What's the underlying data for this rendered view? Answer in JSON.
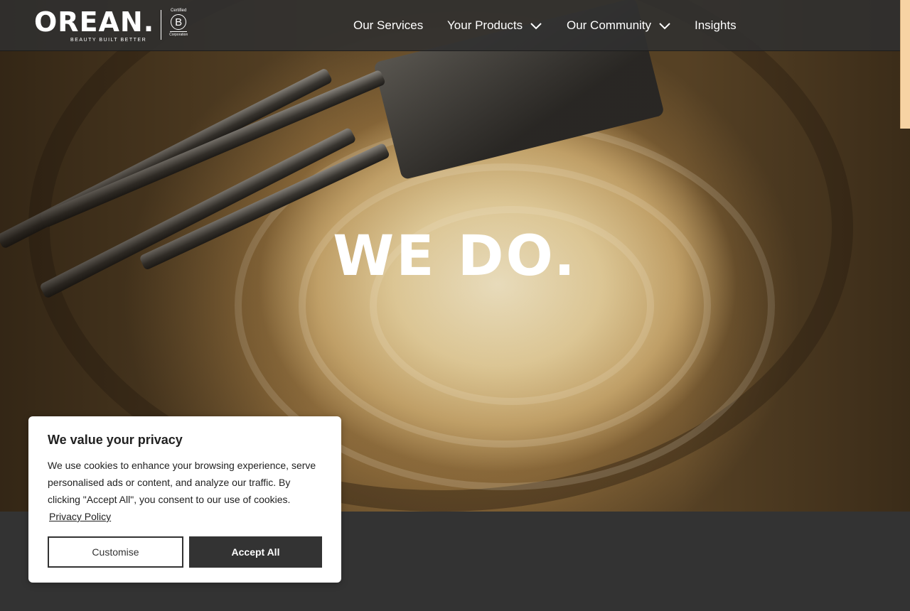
{
  "header": {
    "logo": {
      "wordmark": "OREAN.",
      "tagline": "BEAUTY BUILT BETTER",
      "bcorp_top": "Certified",
      "bcorp_letter": "B",
      "bcorp_bottom": "Corporation"
    },
    "nav": [
      {
        "label": "Our Services",
        "has_dropdown": false
      },
      {
        "label": "Your Products",
        "has_dropdown": true
      },
      {
        "label": "Our Community",
        "has_dropdown": true
      },
      {
        "label": "Insights",
        "has_dropdown": false
      }
    ]
  },
  "hero": {
    "headline": "WE DO."
  },
  "cookie_banner": {
    "title": "We value your privacy",
    "body": "We use cookies to enhance your browsing experience, serve personalised ads or content, and analyze our traffic. By clicking \"Accept All\", you consent to our use of cookies.",
    "policy_link": "Privacy Policy",
    "customise_label": "Customise",
    "accept_label": "Accept All"
  },
  "colors": {
    "header_bg": "#303030",
    "footer_bg": "#333333",
    "accent_scroll": "#f7d3a3",
    "button_dark": "#333333"
  }
}
